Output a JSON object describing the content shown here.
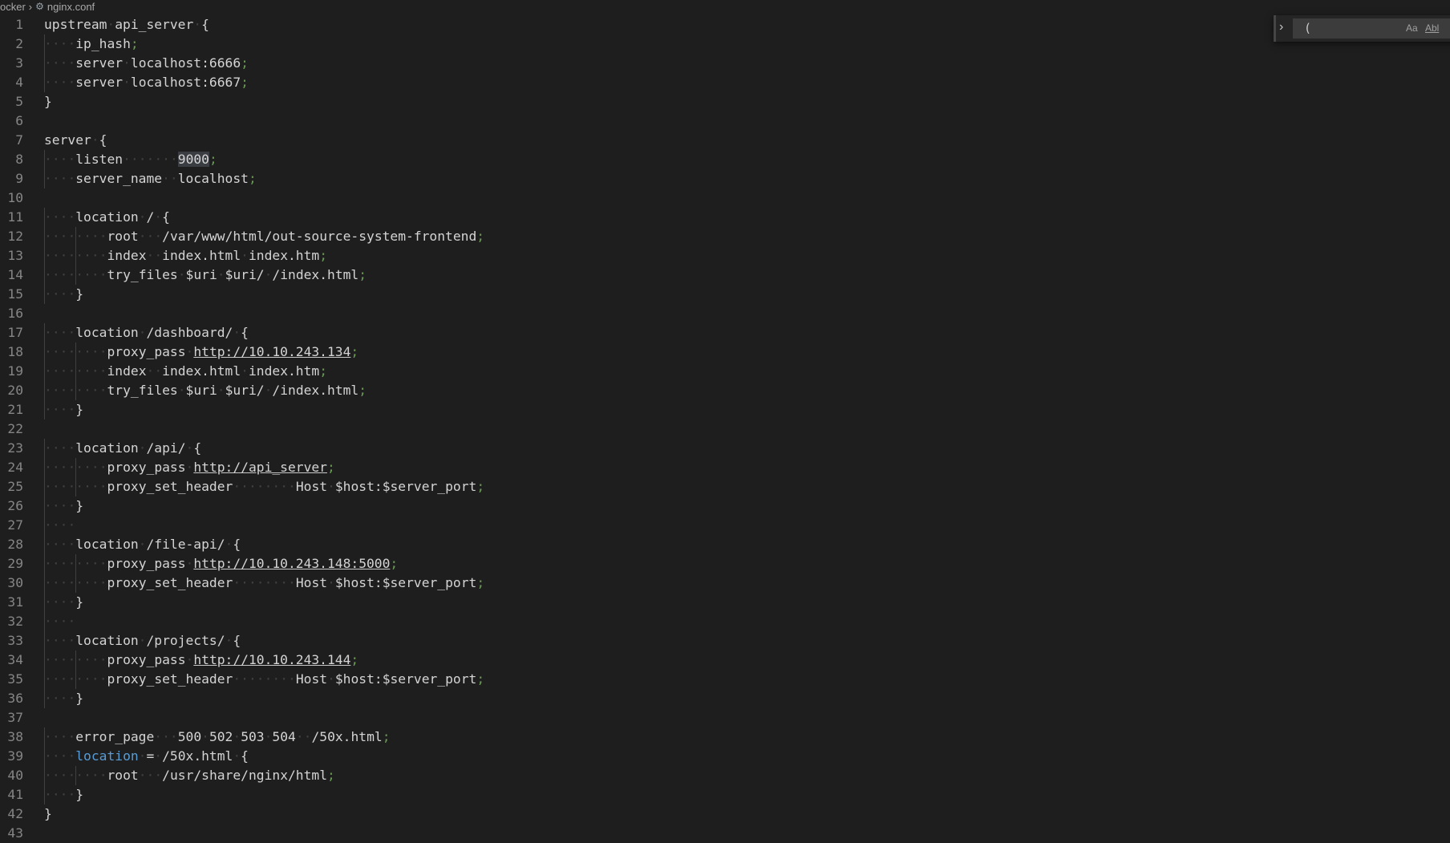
{
  "breadcrumb": {
    "folder": "ocker",
    "file": "nginx.conf"
  },
  "find_widget": {
    "query": "(",
    "match_case_label": "Aa",
    "whole_word_label": "Abl"
  },
  "colors": {
    "background": "#1e1e1e",
    "text": "#d4d4d4",
    "semicolon": "#6a9955",
    "keyword": "#569cd6",
    "line_number": "#858585"
  },
  "editor": {
    "lines": [
      "upstream api_server {",
      "    ip_hash;",
      "    server localhost:6666;",
      "    server localhost:6667;",
      "}",
      "",
      "server {",
      "    listen       9000;",
      "    server_name  localhost;",
      "",
      "    location / {",
      "        root   /var/www/html/out-source-system-frontend;",
      "        index  index.html index.htm;",
      "        try_files $uri $uri/ /index.html;",
      "    }",
      "",
      "    location /dashboard/ {",
      "        proxy_pass http://10.10.243.134;",
      "        index  index.html index.htm;",
      "        try_files $uri $uri/ /index.html;",
      "    }",
      "",
      "    location /api/ {",
      "        proxy_pass http://api_server;",
      "        proxy_set_header        Host $host:$server_port;",
      "    }",
      "    ",
      "    location /file-api/ {",
      "        proxy_pass http://10.10.243.148:5000;",
      "        proxy_set_header        Host $host:$server_port;",
      "    }",
      "    ",
      "    location /projects/ {",
      "        proxy_pass http://10.10.243.144;",
      "        proxy_set_header        Host $host:$server_port;",
      "    }",
      "",
      "    error_page   500 502 503 504  /50x.html;",
      "    location = /50x.html {",
      "        root   /usr/share/nginx/html;",
      "    }",
      "}",
      ""
    ],
    "highlighted_word": "9000",
    "keyword_lines": [
      39
    ]
  }
}
